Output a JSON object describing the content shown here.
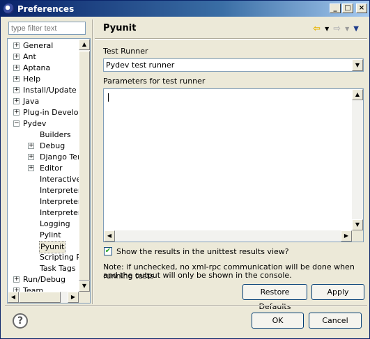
{
  "window": {
    "title": "Preferences",
    "min_label": "_",
    "max_label": "□",
    "close_label": "×"
  },
  "filter": {
    "placeholder": "type filter text"
  },
  "tree": {
    "items": [
      {
        "label": "General",
        "expander": "+"
      },
      {
        "label": "Ant",
        "expander": "+"
      },
      {
        "label": "Aptana",
        "expander": "+"
      },
      {
        "label": "Help",
        "expander": "+"
      },
      {
        "label": "Install/Update",
        "expander": "+"
      },
      {
        "label": "Java",
        "expander": "+"
      },
      {
        "label": "Plug-in Develop",
        "expander": "+"
      },
      {
        "label": "Pydev",
        "expander": "−"
      },
      {
        "label": "Builders",
        "expander": ""
      },
      {
        "label": "Debug",
        "expander": "+"
      },
      {
        "label": "Django Tem",
        "expander": "+"
      },
      {
        "label": "Editor",
        "expander": "+"
      },
      {
        "label": "Interactive",
        "expander": ""
      },
      {
        "label": "Interpreter",
        "expander": ""
      },
      {
        "label": "Interpreter",
        "expander": ""
      },
      {
        "label": "Interpreter",
        "expander": ""
      },
      {
        "label": "Logging",
        "expander": ""
      },
      {
        "label": "Pylint",
        "expander": ""
      },
      {
        "label": "Pyunit",
        "expander": ""
      },
      {
        "label": "Scripting Py",
        "expander": ""
      },
      {
        "label": "Task Tags",
        "expander": ""
      },
      {
        "label": "Run/Debug",
        "expander": "+"
      },
      {
        "label": "Team",
        "expander": "+"
      }
    ],
    "selected": "Pyunit"
  },
  "page": {
    "title": "Pyunit",
    "test_runner_label": "Test Runner",
    "test_runner_value": "Pydev test runner",
    "params_label": "Parameters for test runner",
    "params_value": "",
    "show_results_label": "Show the results in the unittest results view?",
    "show_results_checked": true,
    "note_line1": "Note: if unchecked, no xml-rpc communication will be done when running tests",
    "note_line2": "and the output will only be shown in the console.",
    "restore_defaults_label": "Restore Defaults",
    "apply_label": "Apply"
  },
  "footer": {
    "help_label": "?",
    "ok_label": "OK",
    "cancel_label": "Cancel"
  },
  "icons": {
    "back": "back-arrow-icon",
    "forward": "forward-arrow-icon",
    "menu": "view-menu-icon"
  },
  "colors": {
    "titlebar_start": "#0a246a",
    "dialog_bg": "#ece9d8",
    "back_arrow": "#e8b400"
  }
}
